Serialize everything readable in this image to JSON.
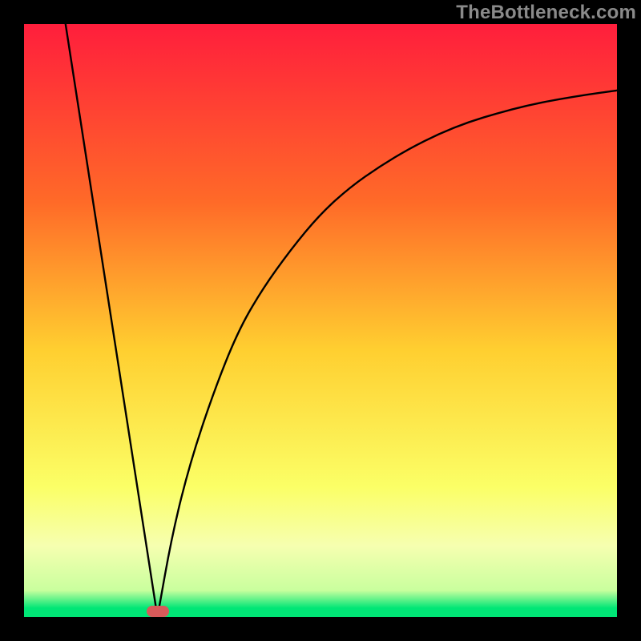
{
  "watermark": "TheBottleneck.com",
  "colors": {
    "red": "#ff1e3c",
    "orange": "#ff8c1e",
    "yellow": "#ffe93c",
    "lightyellow": "#fbff8c",
    "green": "#00e676",
    "black": "#000000",
    "marker": "#d75a5a"
  },
  "chart_data": {
    "type": "line",
    "title": "",
    "xlabel": "",
    "ylabel": "",
    "xlim": [
      0,
      100
    ],
    "ylim": [
      0,
      100
    ],
    "gradient_stops": [
      {
        "pos": 0.0,
        "color": "#ff1e3c"
      },
      {
        "pos": 0.3,
        "color": "#ff6a28"
      },
      {
        "pos": 0.55,
        "color": "#ffcf30"
      },
      {
        "pos": 0.78,
        "color": "#fbff66"
      },
      {
        "pos": 0.88,
        "color": "#f6ffb0"
      },
      {
        "pos": 0.955,
        "color": "#c9ff9e"
      },
      {
        "pos": 0.985,
        "color": "#00e676"
      },
      {
        "pos": 1.0,
        "color": "#00e676"
      }
    ],
    "marker": {
      "x": 22.5,
      "y": 1.0
    },
    "series": [
      {
        "name": "left-branch",
        "x": [
          7,
          22.5
        ],
        "y": [
          100,
          0
        ]
      },
      {
        "name": "right-branch",
        "x": [
          22.5,
          25,
          28,
          32,
          36,
          40,
          45,
          50,
          55,
          60,
          65,
          70,
          75,
          80,
          85,
          90,
          95,
          100
        ],
        "y": [
          0,
          14,
          26,
          38,
          48,
          55,
          62,
          68,
          72.5,
          76,
          79,
          81.5,
          83.5,
          85,
          86.3,
          87.3,
          88.1,
          88.8
        ]
      }
    ]
  }
}
